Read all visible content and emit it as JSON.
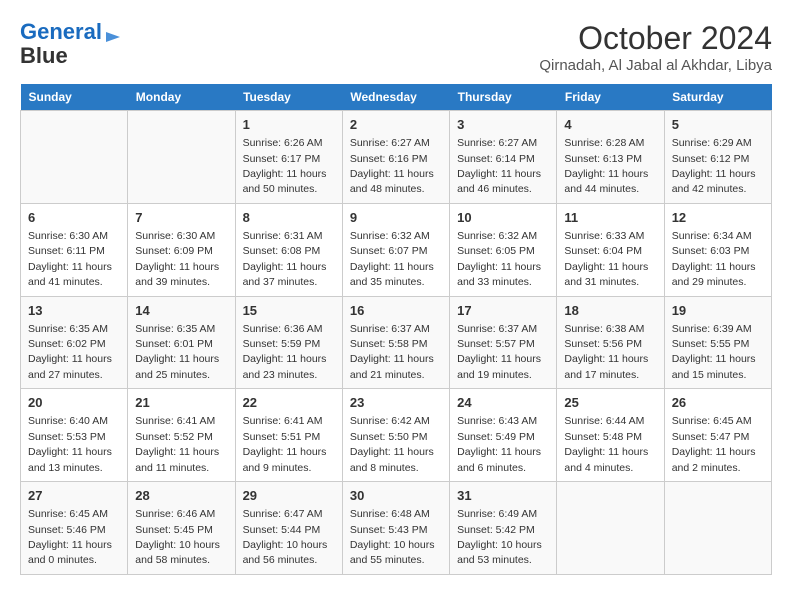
{
  "header": {
    "logo_line1": "General",
    "logo_line2": "Blue",
    "title": "October 2024",
    "subtitle": "Qirnadah, Al Jabal al Akhdar, Libya"
  },
  "weekdays": [
    "Sunday",
    "Monday",
    "Tuesday",
    "Wednesday",
    "Thursday",
    "Friday",
    "Saturday"
  ],
  "weeks": [
    [
      {
        "day": "",
        "info": ""
      },
      {
        "day": "",
        "info": ""
      },
      {
        "day": "1",
        "info": "Sunrise: 6:26 AM\nSunset: 6:17 PM\nDaylight: 11 hours and 50 minutes."
      },
      {
        "day": "2",
        "info": "Sunrise: 6:27 AM\nSunset: 6:16 PM\nDaylight: 11 hours and 48 minutes."
      },
      {
        "day": "3",
        "info": "Sunrise: 6:27 AM\nSunset: 6:14 PM\nDaylight: 11 hours and 46 minutes."
      },
      {
        "day": "4",
        "info": "Sunrise: 6:28 AM\nSunset: 6:13 PM\nDaylight: 11 hours and 44 minutes."
      },
      {
        "day": "5",
        "info": "Sunrise: 6:29 AM\nSunset: 6:12 PM\nDaylight: 11 hours and 42 minutes."
      }
    ],
    [
      {
        "day": "6",
        "info": "Sunrise: 6:30 AM\nSunset: 6:11 PM\nDaylight: 11 hours and 41 minutes."
      },
      {
        "day": "7",
        "info": "Sunrise: 6:30 AM\nSunset: 6:09 PM\nDaylight: 11 hours and 39 minutes."
      },
      {
        "day": "8",
        "info": "Sunrise: 6:31 AM\nSunset: 6:08 PM\nDaylight: 11 hours and 37 minutes."
      },
      {
        "day": "9",
        "info": "Sunrise: 6:32 AM\nSunset: 6:07 PM\nDaylight: 11 hours and 35 minutes."
      },
      {
        "day": "10",
        "info": "Sunrise: 6:32 AM\nSunset: 6:05 PM\nDaylight: 11 hours and 33 minutes."
      },
      {
        "day": "11",
        "info": "Sunrise: 6:33 AM\nSunset: 6:04 PM\nDaylight: 11 hours and 31 minutes."
      },
      {
        "day": "12",
        "info": "Sunrise: 6:34 AM\nSunset: 6:03 PM\nDaylight: 11 hours and 29 minutes."
      }
    ],
    [
      {
        "day": "13",
        "info": "Sunrise: 6:35 AM\nSunset: 6:02 PM\nDaylight: 11 hours and 27 minutes."
      },
      {
        "day": "14",
        "info": "Sunrise: 6:35 AM\nSunset: 6:01 PM\nDaylight: 11 hours and 25 minutes."
      },
      {
        "day": "15",
        "info": "Sunrise: 6:36 AM\nSunset: 5:59 PM\nDaylight: 11 hours and 23 minutes."
      },
      {
        "day": "16",
        "info": "Sunrise: 6:37 AM\nSunset: 5:58 PM\nDaylight: 11 hours and 21 minutes."
      },
      {
        "day": "17",
        "info": "Sunrise: 6:37 AM\nSunset: 5:57 PM\nDaylight: 11 hours and 19 minutes."
      },
      {
        "day": "18",
        "info": "Sunrise: 6:38 AM\nSunset: 5:56 PM\nDaylight: 11 hours and 17 minutes."
      },
      {
        "day": "19",
        "info": "Sunrise: 6:39 AM\nSunset: 5:55 PM\nDaylight: 11 hours and 15 minutes."
      }
    ],
    [
      {
        "day": "20",
        "info": "Sunrise: 6:40 AM\nSunset: 5:53 PM\nDaylight: 11 hours and 13 minutes."
      },
      {
        "day": "21",
        "info": "Sunrise: 6:41 AM\nSunset: 5:52 PM\nDaylight: 11 hours and 11 minutes."
      },
      {
        "day": "22",
        "info": "Sunrise: 6:41 AM\nSunset: 5:51 PM\nDaylight: 11 hours and 9 minutes."
      },
      {
        "day": "23",
        "info": "Sunrise: 6:42 AM\nSunset: 5:50 PM\nDaylight: 11 hours and 8 minutes."
      },
      {
        "day": "24",
        "info": "Sunrise: 6:43 AM\nSunset: 5:49 PM\nDaylight: 11 hours and 6 minutes."
      },
      {
        "day": "25",
        "info": "Sunrise: 6:44 AM\nSunset: 5:48 PM\nDaylight: 11 hours and 4 minutes."
      },
      {
        "day": "26",
        "info": "Sunrise: 6:45 AM\nSunset: 5:47 PM\nDaylight: 11 hours and 2 minutes."
      }
    ],
    [
      {
        "day": "27",
        "info": "Sunrise: 6:45 AM\nSunset: 5:46 PM\nDaylight: 11 hours and 0 minutes."
      },
      {
        "day": "28",
        "info": "Sunrise: 6:46 AM\nSunset: 5:45 PM\nDaylight: 10 hours and 58 minutes."
      },
      {
        "day": "29",
        "info": "Sunrise: 6:47 AM\nSunset: 5:44 PM\nDaylight: 10 hours and 56 minutes."
      },
      {
        "day": "30",
        "info": "Sunrise: 6:48 AM\nSunset: 5:43 PM\nDaylight: 10 hours and 55 minutes."
      },
      {
        "day": "31",
        "info": "Sunrise: 6:49 AM\nSunset: 5:42 PM\nDaylight: 10 hours and 53 minutes."
      },
      {
        "day": "",
        "info": ""
      },
      {
        "day": "",
        "info": ""
      }
    ]
  ]
}
